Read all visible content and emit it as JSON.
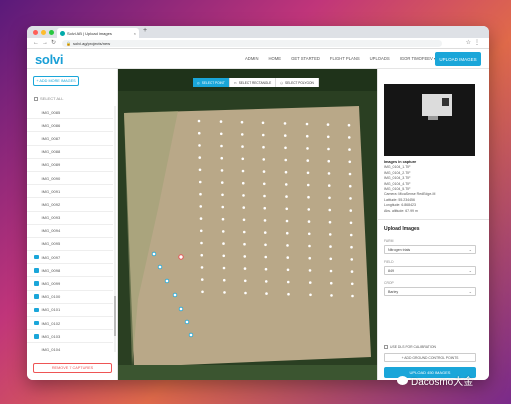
{
  "browser": {
    "tab_title": "Solvi AB | Upload images",
    "url": "solvi.ag/projects/new"
  },
  "colors": {
    "accent": "#1aa6d9",
    "danger": "#e55555",
    "field_soil": "#b9a888",
    "vegetation": "#2a3f22"
  },
  "app": {
    "logo": "solvi",
    "nav": [
      "ADMIN",
      "HOME",
      "GET STARTED",
      "FLIGHT PLANS",
      "UPLOADS",
      "IGOR TIMOFEEV ▾"
    ],
    "upload_button": "UPLOAD IMAGES"
  },
  "sidebar": {
    "add_button": "+ ADD MORE IMAGES",
    "select_all": "SELECT ALL",
    "images": [
      {
        "name": "IMG_0085",
        "checked": false
      },
      {
        "name": "IMG_0086",
        "checked": false
      },
      {
        "name": "IMG_0087",
        "checked": false
      },
      {
        "name": "IMG_0088",
        "checked": false
      },
      {
        "name": "IMG_0089",
        "checked": false
      },
      {
        "name": "IMG_0090",
        "checked": false
      },
      {
        "name": "IMG_0091",
        "checked": false
      },
      {
        "name": "IMG_0092",
        "checked": false
      },
      {
        "name": "IMG_0093",
        "checked": false
      },
      {
        "name": "IMG_0094",
        "checked": false
      },
      {
        "name": "IMG_0095",
        "checked": false
      },
      {
        "name": "IMG_0097",
        "checked": true
      },
      {
        "name": "IMG_0098",
        "checked": true
      },
      {
        "name": "IMG_0099",
        "checked": true
      },
      {
        "name": "IMG_0100",
        "checked": true
      },
      {
        "name": "IMG_0101",
        "checked": true
      },
      {
        "name": "IMG_0102",
        "checked": true
      },
      {
        "name": "IMG_0103",
        "checked": true
      },
      {
        "name": "IMG_0104",
        "checked": false
      }
    ],
    "remove_button": "REMOVE 7 CAPTURES"
  },
  "map": {
    "tools": [
      {
        "label": "SELECT POINT",
        "icon": "target-icon",
        "active": true
      },
      {
        "label": "SELECT RECTANGLE",
        "icon": "rectangle-icon",
        "active": false
      },
      {
        "label": "SELECT POLYGON",
        "icon": "polygon-icon",
        "active": false
      }
    ]
  },
  "right": {
    "capture_heading": "Images in capture",
    "files": [
      "IMG_0104_1.TIF",
      "IMG_0104_2.TIF",
      "IMG_0104_3.TIF",
      "IMG_0104_4.TIF",
      "IMG_0104_5.TIF"
    ],
    "camera": "Camera: MicaSense RedEdge-M",
    "latitude": "Latitude: 55.234456",
    "longitude": "Longitude: 6.868423",
    "altitude": "Abs. altitude: 67.99 m",
    "upload_title": "Upload Images",
    "farm_label": "FARM",
    "farm_value": "Nitrogen trials",
    "field_label": "FIELD",
    "field_value": "849",
    "crop_label": "CROP",
    "crop_value": "Barley",
    "calib_label": "USE DLS FOR CALIBRATION",
    "gcp_button": "+ ADD GROUND CONTROL POINTS",
    "final_button": "UPLOAD 450 IMAGES"
  },
  "watermark": "Dacosmo大金"
}
